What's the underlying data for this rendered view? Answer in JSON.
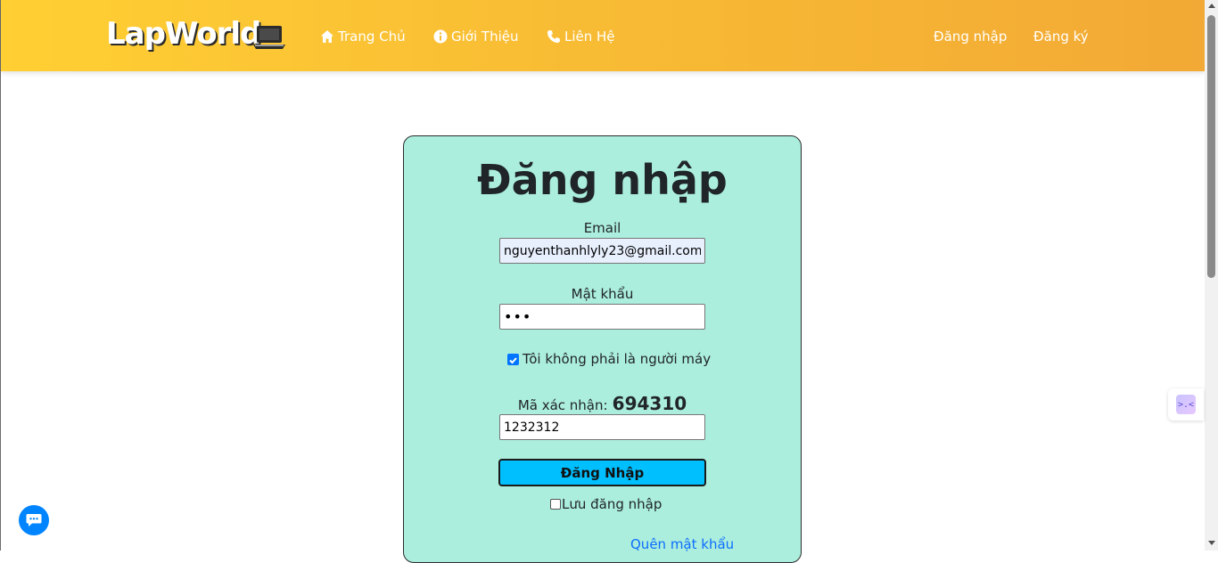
{
  "navbar": {
    "brand": "LapWorld",
    "brand_icon": "laptop-icon",
    "left_items": [
      {
        "label": "Trang Chủ",
        "icon": "home-icon"
      },
      {
        "label": "Giới Thiệu",
        "icon": "info-icon"
      },
      {
        "label": "Liên Hệ",
        "icon": "phone-icon"
      }
    ],
    "right_items": [
      {
        "label": "Đăng nhập"
      },
      {
        "label": "Đăng ký"
      }
    ],
    "gradient_colors": [
      "#ffcf33",
      "#f2a935"
    ]
  },
  "login": {
    "title": "Đăng nhập",
    "email_label": "Email",
    "email_value": "nguyenthanhlyly23@gmail.com",
    "password_label": "Mật khẩu",
    "password_value": "•••",
    "robot_check_label": "Tôi không phải là người máy",
    "robot_checked": true,
    "captcha_label": "Mã xác nhận:",
    "captcha_code": "694310",
    "captcha_input_value": "1232312",
    "submit_label": "Đăng Nhập",
    "remember_label": "Lưu đăng nhập",
    "remember_checked": false,
    "forgot_label": "Quên mật khẩu",
    "card_color": "#abeedd",
    "button_color": "#00bfff"
  },
  "floating": {
    "chat_icon": "chat-bubble-icon",
    "side_widget_icon": "assistant-icon",
    "side_widget_text": ">.<"
  }
}
